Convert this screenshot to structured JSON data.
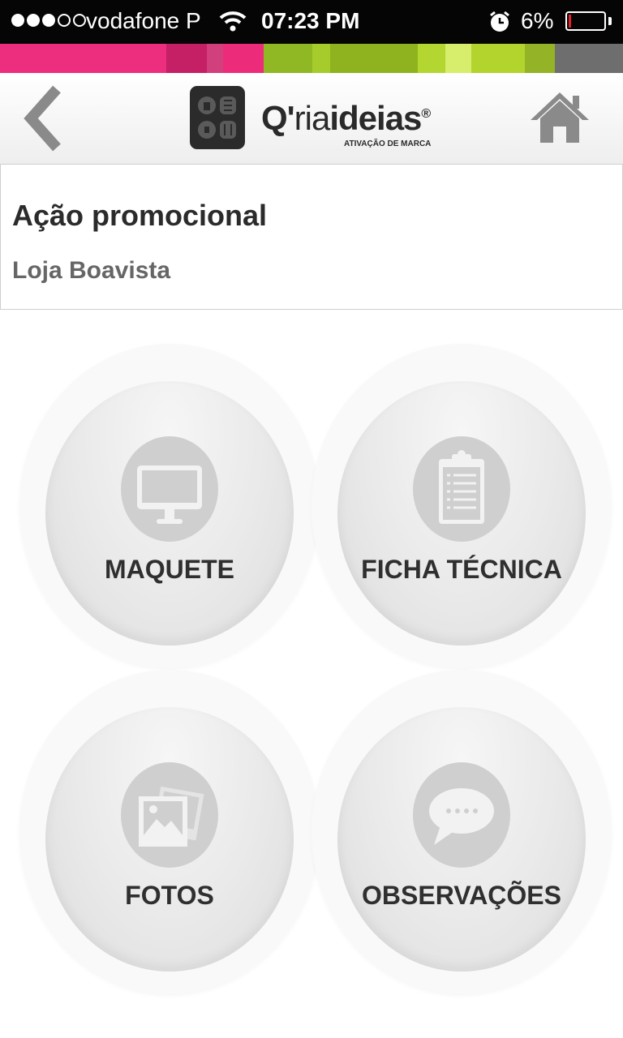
{
  "status_bar": {
    "signal_bars_filled": 3,
    "signal_bars_total": 5,
    "carrier": "vodafone P",
    "time": "07:23 PM",
    "battery_percent": "6%",
    "battery_color": "#e8202a"
  },
  "brand_strip_colors": [
    "#ed2d7d",
    "#c51f66",
    "#d13f7c",
    "#ec2c7a",
    "#8fb824",
    "#a6cc2c",
    "#8fb21f",
    "#b4d630",
    "#d6ee6c",
    "#b3d42c",
    "#95b326",
    "#6e6e6e"
  ],
  "header": {
    "logo_wordmark_prefix": "Q'",
    "logo_wordmark_light": "ria",
    "logo_wordmark_bold": "ideias",
    "logo_registered": "®",
    "logo_tagline": "ATIVAÇÃO DE MARCA",
    "back_icon": "chevron-left-icon",
    "home_icon": "home-icon"
  },
  "info": {
    "title": "Ação promocional",
    "subtitle": "Loja Boavista"
  },
  "menu": {
    "maquete": {
      "label": "MAQUETE",
      "icon": "monitor-icon"
    },
    "ficha": {
      "label": "FICHA TÉCNICA",
      "icon": "clipboard-icon"
    },
    "fotos": {
      "label": "FOTOS",
      "icon": "photos-icon"
    },
    "obs": {
      "label": "OBSERVAÇÕES",
      "icon": "chat-bubble-icon"
    }
  }
}
